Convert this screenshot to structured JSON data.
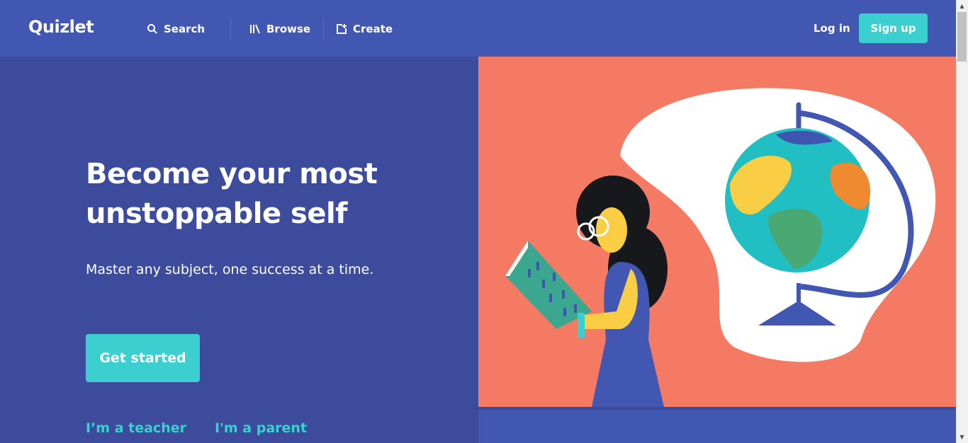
{
  "header": {
    "logo": "Quizlet",
    "nav": [
      {
        "label": "Search",
        "icon": "search-icon"
      },
      {
        "label": "Browse",
        "icon": "library-icon"
      },
      {
        "label": "Create",
        "icon": "create-icon"
      }
    ],
    "login_label": "Log in",
    "signup_label": "Sign up"
  },
  "hero": {
    "headline": "Become your most unstoppable self",
    "subline": "Master any subject, one success at a time.",
    "cta_label": "Get started",
    "teacher_link": "I’m a teacher",
    "parent_link": "I'm a parent",
    "illustration": "girl-reading-with-globe-illustration"
  },
  "colors": {
    "header_bg": "#4257b2",
    "hero_bg": "#3d4b9c",
    "accent": "#3ccfcf",
    "illustration_bg": "#f47a63"
  }
}
